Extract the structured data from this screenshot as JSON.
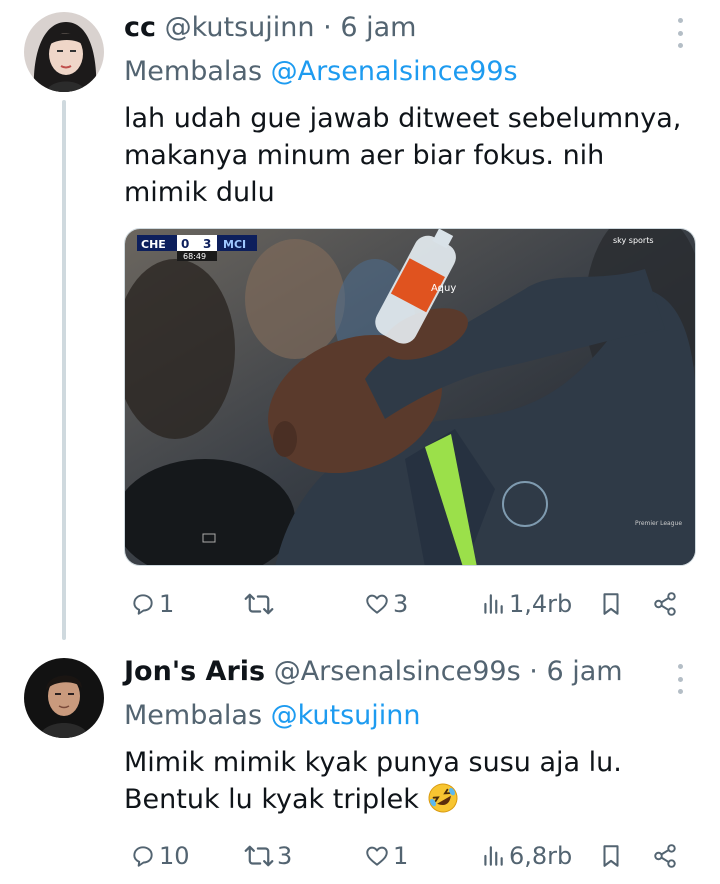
{
  "tweets": [
    {
      "display_name": "cc",
      "handle": "@kutsujinn",
      "separator": "·",
      "time": "6 jam",
      "replying_label": "Membalas",
      "replying_to": "@Arsenalsince99s",
      "text_lines": [
        "lah udah gue jawab ditweet sebelumnya,",
        "makanya minum aer biar fokus. nih",
        "mimik dulu"
      ],
      "media": {
        "score_home": "CHE",
        "score_home_goals": "0",
        "score_away_goals": "3",
        "score_away": "MCI",
        "clock": "68:49",
        "bottle_label": "Aquy",
        "broadcaster": "sky sports",
        "watermark": "Premier League"
      },
      "stats": {
        "replies": "1",
        "retweets": "",
        "likes": "3",
        "views": "1,4rb"
      }
    },
    {
      "display_name": "Jon's Aris",
      "handle": "@Arsenalsince99s",
      "separator": "·",
      "time": "6 jam",
      "replying_label": "Membalas",
      "replying_to": "@kutsujinn",
      "text_lines": [
        "Mimik mimik kyak punya susu aja lu.",
        "Bentuk lu kyak triplek"
      ],
      "emoji": "rolling-on-floor-laughing",
      "stats": {
        "replies": "10",
        "retweets": "3",
        "likes": "1",
        "views": "6,8rb"
      }
    }
  ],
  "colors": {
    "link": "#1d9bf0",
    "secondary": "#536471",
    "text": "#0f1419",
    "line": "#cfd9de"
  }
}
